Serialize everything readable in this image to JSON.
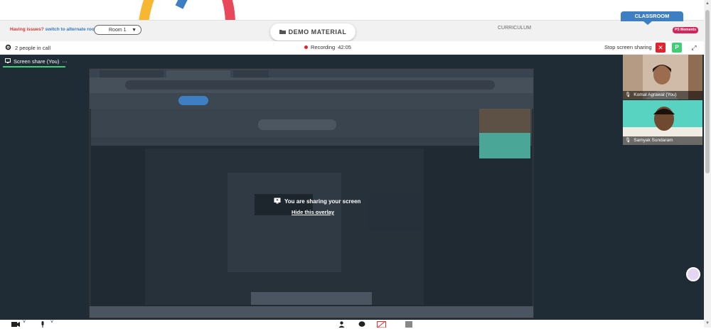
{
  "header": {
    "issue_text": "Having issues?",
    "alt_room_link": "switch to alternate room",
    "room_select_value": "Room 1",
    "demo_material_label": "DEMO MATERIAL",
    "curriculum_label": "CURRICULUM",
    "classroom_tab_label": "CLASSROOM",
    "moments_badge": "PS Moments"
  },
  "callbar": {
    "people_count": "2 people in call",
    "recording_label": "Recording",
    "recording_time": "42:05",
    "stop_sharing_label": "Stop screen sharing",
    "participant_initial": "P"
  },
  "stage": {
    "screen_share_label": "Screen share (You)",
    "more_label": "···",
    "sharing_message": "You are sharing your screen",
    "hide_overlay_label": "Hide this overlay"
  },
  "participants": [
    {
      "name": "Komal Agrawal (You)"
    },
    {
      "name": "Samyak Sundaram"
    }
  ],
  "colors": {
    "recording_red": "#e0242d",
    "accent_green": "#3ecf74",
    "classroom_blue": "#3d7fc2",
    "stage_background": "#1f2b35"
  },
  "icons": [
    "gear-icon",
    "folder-icon",
    "chevron-down-icon",
    "close-icon",
    "expand-icon",
    "screen-share-icon",
    "mic-icon",
    "camera-icon",
    "person-icon",
    "chat-icon",
    "whiteboard-icon"
  ]
}
